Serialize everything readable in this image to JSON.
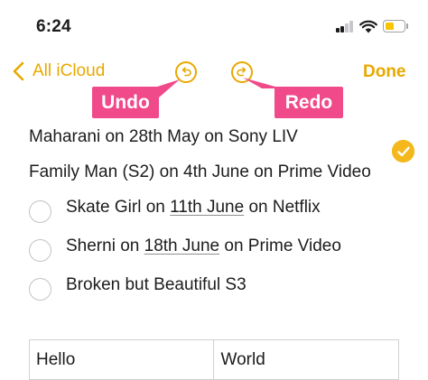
{
  "status_bar": {
    "time": "6:24",
    "signal_bars_active": 2,
    "signal_bars_total": 4,
    "battery_level": 0.45,
    "battery_color": "#f7c600"
  },
  "nav": {
    "back_label": "All iCloud",
    "back_icon": "chevron-left-icon",
    "undo_icon": "undo-icon",
    "redo_icon": "redo-icon",
    "done_label": "Done",
    "accent_color": "#e8a800"
  },
  "annotations": {
    "undo_label": "Undo",
    "redo_label": "Redo",
    "color": "#f04a8a"
  },
  "checklist": [
    {
      "parts": [
        {
          "text": "Maharani on 28th May on Sony LIV",
          "link": false
        }
      ],
      "checked": true
    },
    {
      "parts": [
        {
          "text": "Family Man (S2) on 4th June on Prime Video",
          "link": false
        }
      ],
      "checked": true
    },
    {
      "parts": [
        {
          "text": "Skate Girl on ",
          "link": false
        },
        {
          "text": "11th June",
          "link": true
        },
        {
          "text": " on Netflix",
          "link": false
        }
      ],
      "checked": false
    },
    {
      "parts": [
        {
          "text": "Sherni on ",
          "link": false
        },
        {
          "text": "18th June",
          "link": true
        },
        {
          "text": " on Prime Video",
          "link": false
        }
      ],
      "checked": false
    },
    {
      "parts": [
        {
          "text": "Broken but Beautiful S3",
          "link": false
        }
      ],
      "checked": false
    }
  ],
  "table": {
    "rows": [
      [
        "Hello",
        "World"
      ]
    ]
  }
}
